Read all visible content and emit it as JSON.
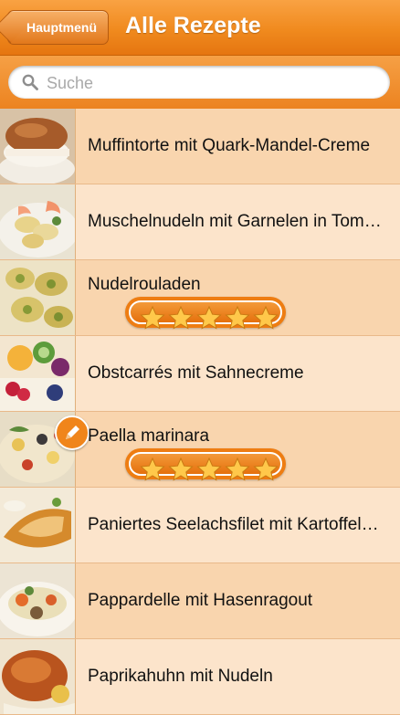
{
  "nav": {
    "back_label": "Hauptmenü",
    "title": "Alle Rezepte"
  },
  "search": {
    "placeholder": "Suche"
  },
  "recipes": [
    {
      "title": "Muffintorte mit Quark-Mandel-Creme",
      "rating": null,
      "edit_icon": false
    },
    {
      "title": "Muschelnudeln mit Garnelen in Tomatensauce",
      "rating": null,
      "edit_icon": false
    },
    {
      "title": "Nudelrouladen",
      "rating": 5,
      "edit_icon": false
    },
    {
      "title": "Obstcarrés mit Sahnecreme",
      "rating": null,
      "edit_icon": false
    },
    {
      "title": "Paella marinara",
      "rating": 5,
      "edit_icon": true
    },
    {
      "title": "Paniertes Seelachsfilet mit Kartoffelsalat",
      "rating": null,
      "edit_icon": false
    },
    {
      "title": "Pappardelle mit Hasenragout",
      "rating": null,
      "edit_icon": false
    },
    {
      "title": "Paprikahuhn mit Nudeln",
      "rating": null,
      "edit_icon": false
    }
  ],
  "colors": {
    "accent": "#ee7d12",
    "row_light": "#fce4cb",
    "row_dark": "#f9d5ae"
  }
}
